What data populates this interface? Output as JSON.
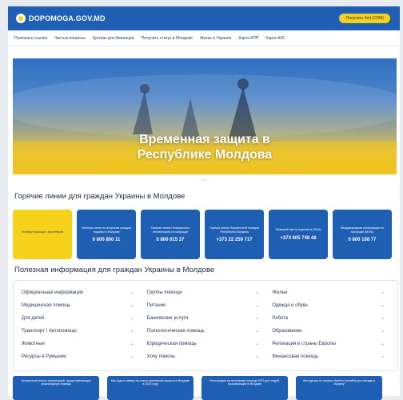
{
  "header": {
    "logo_text": "DOPOMOGA.GOV.MD",
    "help_button": "Получить 4ml (CDM)"
  },
  "nav": [
    "Полезные ссылки",
    "Частые вопросы",
    "Центры для беженцев",
    "Получить статус в Молдове",
    "Жизнь в Украине",
    "Карта КПП",
    "Карта АЗС"
  ],
  "hero": {
    "title_line1": "Временная защита в",
    "title_line2": "Республике Молдова",
    "breadcrumb": "• • •"
  },
  "hotlines": {
    "title": "Горячие линии для граждан Украины в Молдове",
    "cards": [
      {
        "name": "Телефон помощи в волонтеров",
        "phone": "",
        "color": "yellow"
      },
      {
        "name": "Зеленая линия по вопросам граждан Украины в Молдове",
        "phone": "0 800 800 11",
        "color": "blue"
      },
      {
        "name": "Горячая линия Генерального инспектората по миграции",
        "phone": "0 800 015 27",
        "color": "blue"
      },
      {
        "name": "Горячая линия Пограничной полиции Республики Молдова",
        "phone": "+373 22 259 717",
        "color": "blue"
      },
      {
        "name": "Правовой Центр Адвокатов (ПЦА)",
        "phone": "+373 605 748 48",
        "color": "blue"
      },
      {
        "name": "Международная организация по миграции (МОМ)",
        "phone": "0 800 108 77",
        "color": "blue"
      }
    ]
  },
  "info": {
    "title": "Полезная информация для граждан Украины в Молдове",
    "items": [
      "Официальная информация",
      "Группы помощи",
      "Жилье",
      "Медицинская помощь",
      "Питание",
      "Одежда и обувь",
      "Для детей",
      "Банковские услуги",
      "Работа",
      "Транспорт / Автопомощь",
      "Психологическая помощь",
      "Образование",
      "Животные",
      "Юридическая помощь",
      "Релокация в страны Европы",
      "Ресурсы в Румынии",
      "Хочу помочь",
      "Финансовая помощь"
    ]
  },
  "bottom_cards": [
    "Актуальный список организаций, предоставляющих гуманитарную помощь",
    "Как подать заявку на статус временной защиты в Молдове в 2023 году",
    "Регистрация на программу помощи ВПП для людей, проживающих в Молдове",
    "Инструкция по покупке билета (онлайн) для поездки в Украину"
  ],
  "colors": {
    "brand_blue": "#1f5fb3",
    "brand_yellow": "#f7d21a"
  }
}
